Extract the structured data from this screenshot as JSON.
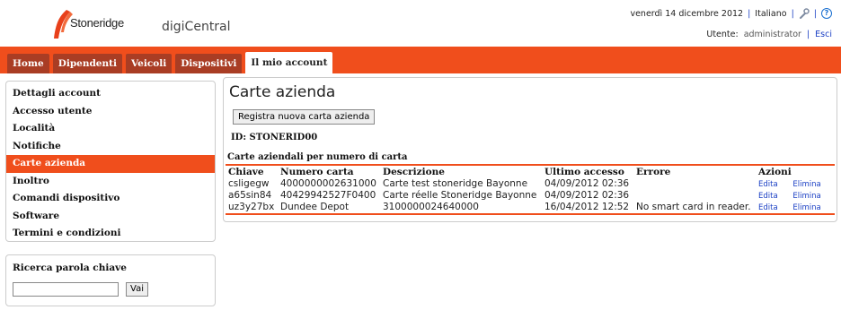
{
  "header": {
    "logo_text": "Stoneridge",
    "app_name": "digiCentral",
    "date": "venerdì 14 dicembre 2012",
    "language": "Italiano",
    "user_label": "Utente:",
    "user_name": "administrator",
    "logout": "Esci",
    "icons": [
      "wrench-icon",
      "help-icon"
    ]
  },
  "nav": {
    "tabs": [
      "Home",
      "Dipendenti",
      "Veicoli",
      "Dispositivi",
      "Il mio account"
    ],
    "active": "Il mio account"
  },
  "sidebar": {
    "items": [
      "Dettagli account",
      "Accesso utente",
      "Località",
      "Notifiche",
      "Carte azienda",
      "Inoltro",
      "Comandi dispositivo",
      "Software",
      "Termini e condizioni"
    ],
    "active": "Carte azienda"
  },
  "search": {
    "title": "Ricerca parola chiave",
    "button": "Vai",
    "value": ""
  },
  "main": {
    "title": "Carte azienda",
    "register_button": "Registra nuova carta azienda",
    "id_line": "ID: STONERID00",
    "section_title": "Carte aziendali per numero di carta",
    "table": {
      "headers": [
        "Chiave",
        "Numero carta",
        "Descrizione",
        "Ultimo accesso",
        "Errore",
        "Azioni"
      ],
      "rows": [
        {
          "key": "csligegw",
          "number": "4000000002631000",
          "description": "Carte test stoneridge Bayonne",
          "last_access": "04/09/2012 02:36",
          "error": "",
          "edit": "Edita",
          "delete": "Elimina"
        },
        {
          "key": "a65sin84",
          "number": "40429942527F0400",
          "description": "Carte réelle Stoneridge Bayonne",
          "last_access": "04/09/2012 02:36",
          "error": "",
          "edit": "Edita",
          "delete": "Elimina"
        },
        {
          "key": "uz3y27bx",
          "number": "Dundee Depot",
          "description": "3100000024640000",
          "last_access": "16/04/2012 12:52",
          "error": "No smart card in reader.",
          "edit": "Edita",
          "delete": "Elimina"
        }
      ]
    }
  },
  "colors": {
    "accent": "#f04e1c",
    "tab_bg": "#a93d24",
    "link": "#1a3fc4"
  }
}
